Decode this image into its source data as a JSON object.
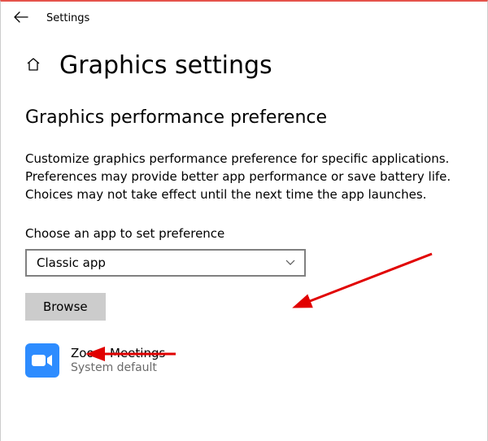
{
  "topbar": {
    "title": "Settings"
  },
  "page": {
    "title": "Graphics settings",
    "section_title": "Graphics performance preference",
    "description": "Customize graphics performance preference for specific applications. Preferences may provide better app performance or save battery life. Choices may not take effect until the next time the app launches.",
    "choose_label": "Choose an app to set preference",
    "dropdown_value": "Classic app",
    "browse_label": "Browse"
  },
  "apps": [
    {
      "name": "Zoom Meetings",
      "preference": "System default"
    }
  ]
}
